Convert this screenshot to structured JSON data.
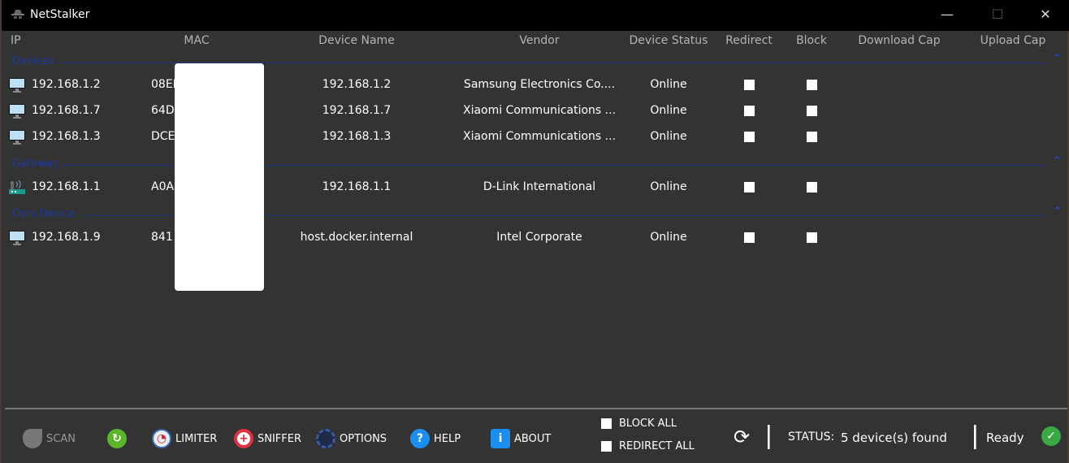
{
  "window": {
    "title": "NetStalker",
    "minimize": "—",
    "maximize": "☐",
    "close": "✕"
  },
  "columns": [
    "IP",
    "MAC",
    "Device Name",
    "Vendor",
    "Device Status",
    "Redirect",
    "Block",
    "Download Cap",
    "Upload Cap"
  ],
  "groups": [
    {
      "label": "Devices",
      "rows": [
        {
          "icon": "monitor-icon",
          "ip": "192.168.1.2",
          "mac": "08EE",
          "name": "192.168.1.2",
          "vendor": "Samsung Electronics Co....",
          "status": "Online",
          "redirect": false,
          "block": false
        },
        {
          "icon": "monitor-icon",
          "ip": "192.168.1.7",
          "mac": "64D",
          "name": "192.168.1.7",
          "vendor": "Xiaomi Communications ...",
          "status": "Online",
          "redirect": false,
          "block": false
        },
        {
          "icon": "monitor-icon",
          "ip": "192.168.1.3",
          "mac": "DCE",
          "name": "192.168.1.3",
          "vendor": "Xiaomi Communications ...",
          "status": "Online",
          "redirect": false,
          "block": false
        }
      ]
    },
    {
      "label": "Gateway",
      "rows": [
        {
          "icon": "router-icon",
          "ip": "192.168.1.1",
          "mac": "A0A",
          "name": "192.168.1.1",
          "vendor": "D-Link International",
          "status": "Online",
          "redirect": false,
          "block": false
        }
      ]
    },
    {
      "label": "Own Device",
      "rows": [
        {
          "icon": "monitor-icon",
          "ip": "192.168.1.9",
          "mac": "841",
          "name": "host.docker.internal",
          "vendor": "Intel Corporate",
          "status": "Online",
          "redirect": false,
          "block": false
        }
      ]
    }
  ],
  "toolbar": {
    "scan": "SCAN",
    "limiter": "LIMITER",
    "sniffer": "SNIFFER",
    "options": "OPTIONS",
    "help": "HELP",
    "about": "ABOUT",
    "block_all": "BLOCK ALL",
    "redirect_all": "REDIRECT ALL"
  },
  "status": {
    "label": "STATUS:",
    "text": "5 device(s) found",
    "state": "Ready"
  },
  "colors": {
    "accent": "#1c3aa0",
    "ok": "#3aa845",
    "refresh": "#5ab52a"
  }
}
